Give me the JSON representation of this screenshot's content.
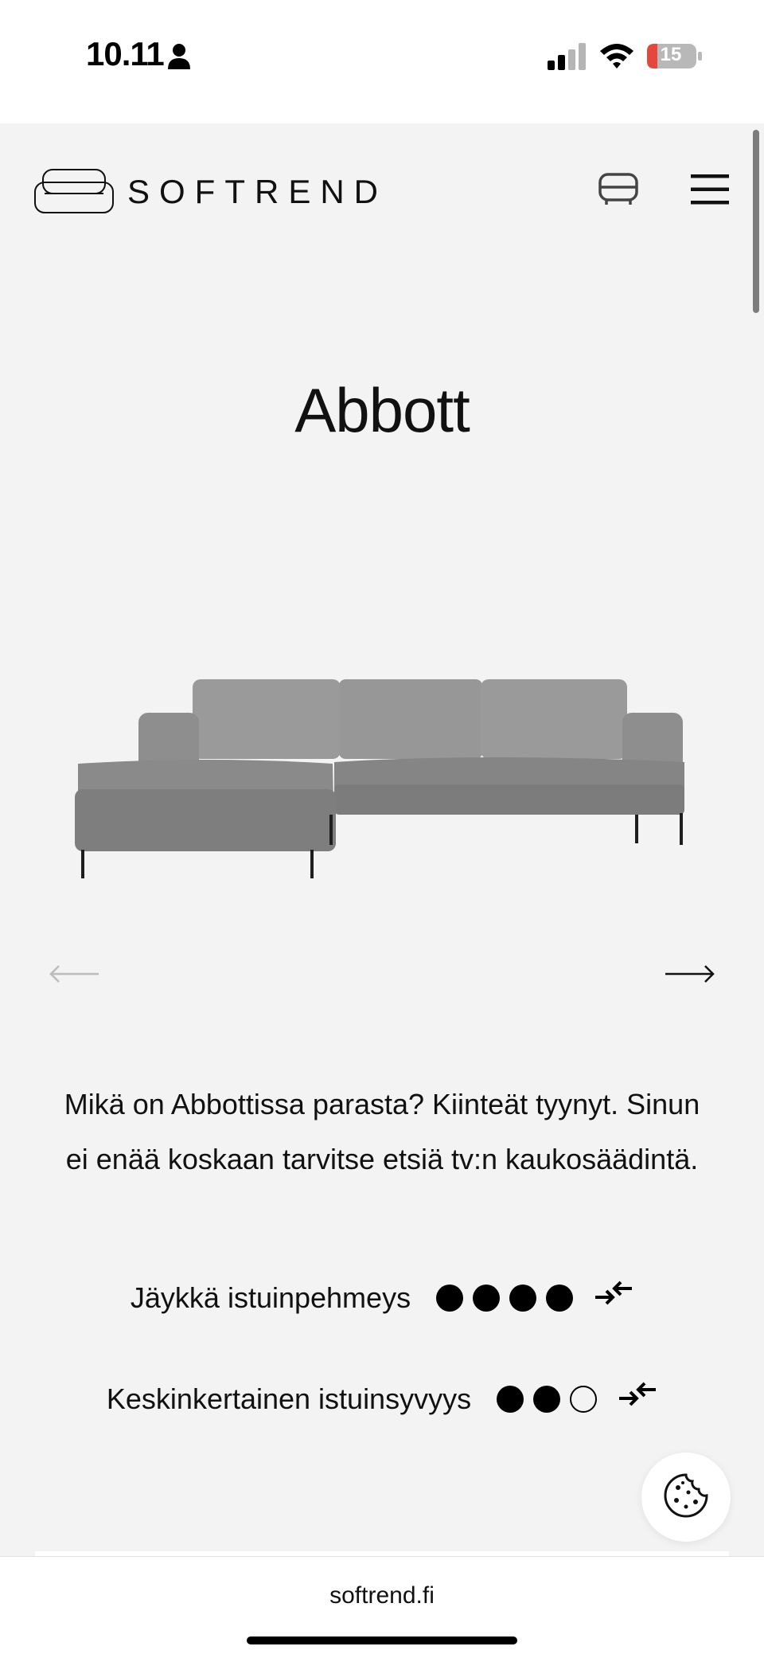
{
  "status_bar": {
    "time": "10.11",
    "battery_level": "15",
    "icons": [
      "person-icon",
      "signal-icon",
      "wifi-icon",
      "battery-icon"
    ]
  },
  "header": {
    "logo_text": "SOFTREND",
    "icons": [
      "sofa-logo-icon",
      "cart-icon",
      "menu-icon"
    ]
  },
  "product": {
    "title": "Abbott",
    "image": "sofa-image",
    "description": "Mikä on Abbottissa parasta? Kiinteät tyynyt. Sinun ei enää koskaan tarvitse etsiä tv:n kaukosäädintä.",
    "features": [
      {
        "label": "Jäykkä istuinpehmeys",
        "rating_filled": 4,
        "rating_total": 4
      },
      {
        "label": "Keskinkertainen istuinsyvyys",
        "rating_filled": 2,
        "rating_total": 3
      }
    ]
  },
  "carousel": {
    "prev_icon": "arrow-left-icon",
    "next_icon": "arrow-right-icon"
  },
  "browser": {
    "url": "softrend.fi"
  },
  "colors": {
    "page_background": "#f3f3f3",
    "text": "#111111",
    "battery_low": "#e5473f"
  }
}
